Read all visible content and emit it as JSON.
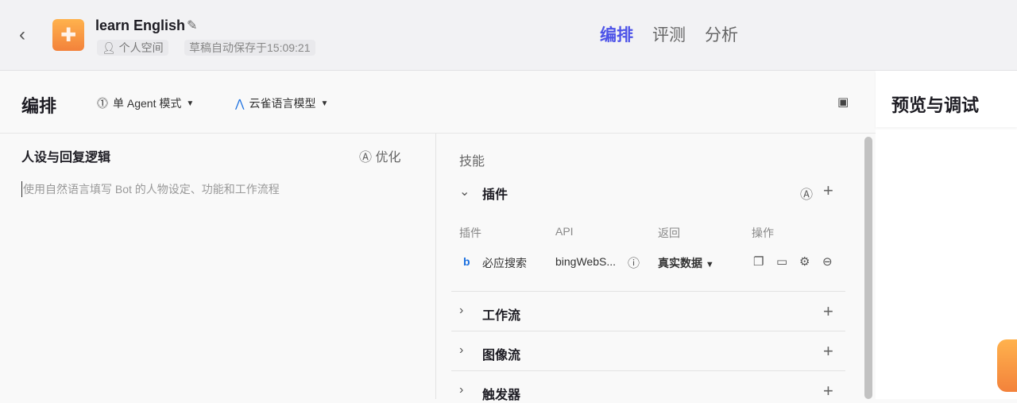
{
  "header": {
    "back_icon": "chevron-left-icon",
    "bot_name": "learn English",
    "space": "个人空间",
    "autosave": "草稿自动保存于15:09:21",
    "tabs": [
      {
        "label": "编排",
        "active": true
      },
      {
        "label": "评测"
      },
      {
        "label": "分析"
      }
    ],
    "accent": "#4d53e8"
  },
  "toolbar": {
    "title": "编排",
    "mode": "单 Agent 模式",
    "model": "云雀语言模型"
  },
  "persona": {
    "title": "人设与回复逻辑",
    "optimize": "优化",
    "placeholder": "使用自然语言填写 Bot 的人物设定、功能和工作流程"
  },
  "skills": {
    "title": "技能",
    "plugin": {
      "label": "插件",
      "columns": [
        "插件",
        "API",
        "返回",
        "操作"
      ],
      "rows": [
        {
          "name": "必应搜索",
          "api": "bingWebS...",
          "return": "真实数据"
        }
      ]
    },
    "sections": [
      {
        "label": "工作流"
      },
      {
        "label": "图像流"
      },
      {
        "label": "触发器"
      }
    ]
  },
  "preview": {
    "title": "预览与调试"
  }
}
